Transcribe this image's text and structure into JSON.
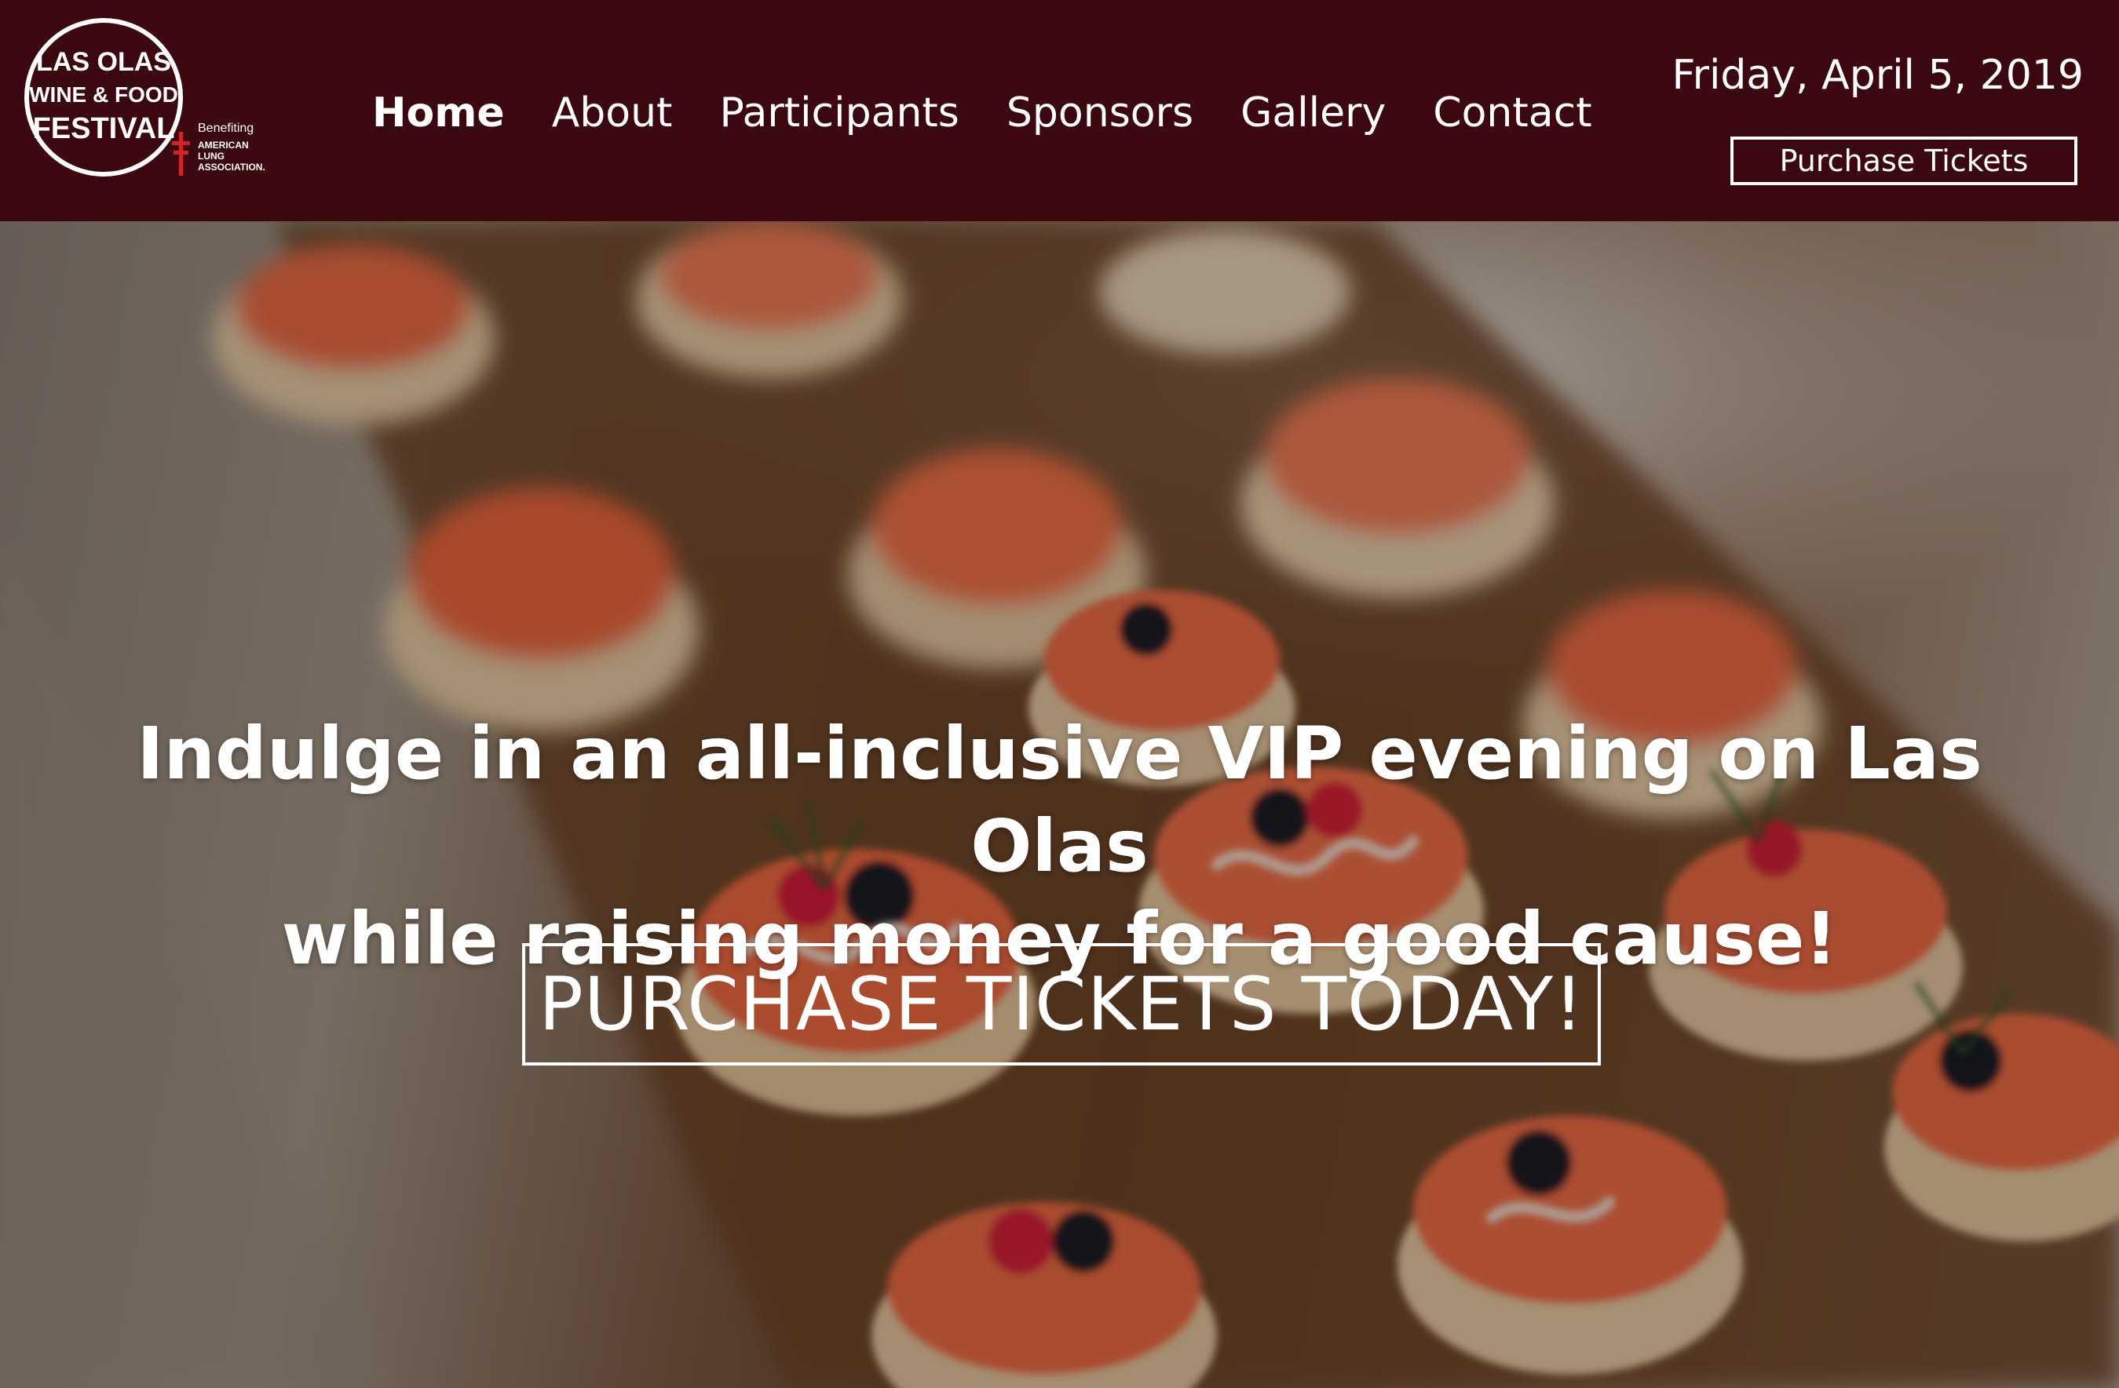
{
  "logo": {
    "line1": "LAS OLAS",
    "line2": "WINE & FOOD",
    "line3": "FESTIVAL",
    "benefiting": "Benefiting",
    "org1": "AMERICAN",
    "org2": "LUNG",
    "org3": "ASSOCIATION."
  },
  "nav": {
    "items": [
      {
        "label": "Home",
        "active": true
      },
      {
        "label": "About"
      },
      {
        "label": "Participants"
      },
      {
        "label": "Sponsors"
      },
      {
        "label": "Gallery"
      },
      {
        "label": "Contact"
      }
    ]
  },
  "header": {
    "date": "Friday, April 5, 2019",
    "purchase_label": "Purchase Tickets"
  },
  "hero": {
    "headline_line1": "Indulge in an all-inclusive VIP evening on Las Olas",
    "headline_line2": "while raising money for a good cause!",
    "cta_label": "PURCHASE TICKETS TODAY!"
  },
  "colors": {
    "header_bg": "#3a080e",
    "text": "#ffffff",
    "lung_red": "#d2232a"
  }
}
